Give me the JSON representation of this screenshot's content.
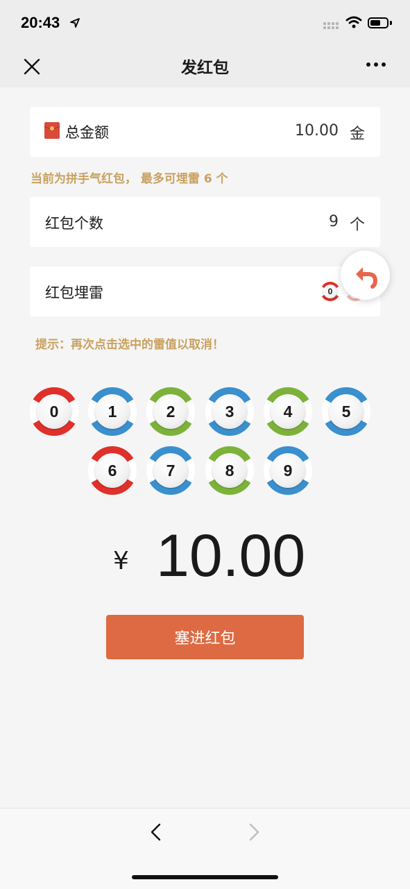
{
  "status_bar": {
    "time": "20:43"
  },
  "nav": {
    "title": "发红包"
  },
  "total_amount": {
    "label": "总金额",
    "value": "10.00",
    "unit": "金"
  },
  "hint_top": "当前为拼手气红包， 最多可埋雷 6 个",
  "count_row": {
    "label": "红包个数",
    "value": "9",
    "unit": "个"
  },
  "mine_row": {
    "label": "红包埋雷",
    "selected": [
      "0",
      "6"
    ]
  },
  "hint_tip": "提示：再次点击选中的雷值以取消！",
  "balls": [
    {
      "num": "0",
      "color": "red"
    },
    {
      "num": "1",
      "color": "blue"
    },
    {
      "num": "2",
      "color": "green"
    },
    {
      "num": "3",
      "color": "blue"
    },
    {
      "num": "4",
      "color": "green"
    },
    {
      "num": "5",
      "color": "blue"
    },
    {
      "num": "6",
      "color": "red"
    },
    {
      "num": "7",
      "color": "blue"
    },
    {
      "num": "8",
      "color": "green"
    },
    {
      "num": "9",
      "color": "blue"
    }
  ],
  "amount_display": {
    "currency": "¥",
    "value": "10.00"
  },
  "submit_label": "塞进红包",
  "colors": {
    "accent": "#dd6a43",
    "hint": "#c9a15f",
    "red": "#e0302a",
    "blue": "#3a8fce",
    "green": "#7cb23a"
  }
}
